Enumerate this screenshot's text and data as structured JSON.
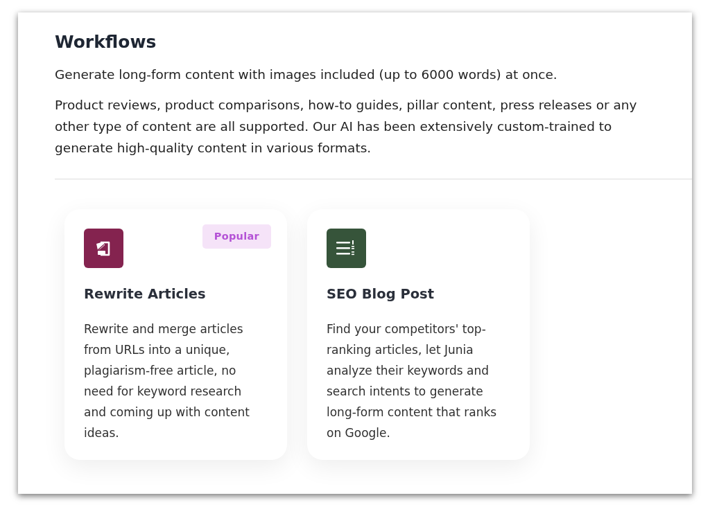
{
  "section": {
    "title": "Workflows",
    "intro": "Generate long-form content with images included (up to 6000 words) at once.",
    "description": "Product reviews, product comparisons, how-to guides, pillar content, press releases or any other type of content are all supported. Our AI has been extensively custom-trained to generate high-quality content in various formats."
  },
  "cards": [
    {
      "kind": "rewrite",
      "color": "#84234f",
      "badge": "Popular",
      "title": "Rewrite Articles",
      "description": "Rewrite and merge articles from URLs into a unique, plagiarism-free article, no need for keyword research and coming up with content ideas."
    },
    {
      "kind": "numbered-list",
      "color": "#36543a",
      "title": "SEO Blog Post",
      "description": "Find your competitors' top-ranking articles, let Junia analyze their keywords and search intents to generate long-form content that ranks on Google."
    }
  ]
}
